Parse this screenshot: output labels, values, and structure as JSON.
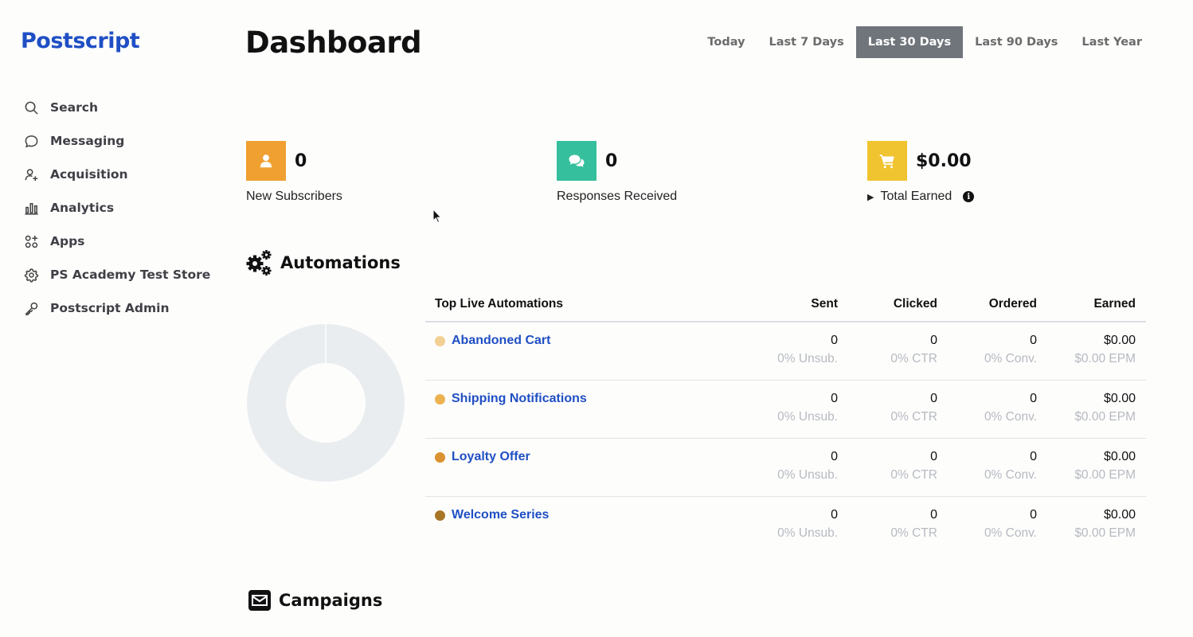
{
  "app": {
    "logo": "Postscript"
  },
  "sidebar": {
    "items": [
      {
        "label": "Search",
        "icon": "search-icon"
      },
      {
        "label": "Messaging",
        "icon": "chat-bubble-icon"
      },
      {
        "label": "Acquisition",
        "icon": "add-user-icon"
      },
      {
        "label": "Analytics",
        "icon": "bar-chart-icon"
      },
      {
        "label": "Apps",
        "icon": "apps-grid-icon"
      },
      {
        "label": "PS Academy Test Store",
        "icon": "gear-icon"
      },
      {
        "label": "Postscript Admin",
        "icon": "key-icon"
      }
    ]
  },
  "header": {
    "title": "Dashboard",
    "ranges": [
      "Today",
      "Last 7 Days",
      "Last 30 Days",
      "Last 90 Days",
      "Last Year"
    ],
    "active_range": "Last 30 Days"
  },
  "stats": [
    {
      "value": "0",
      "label": "New Subscribers",
      "color": "#f0a030",
      "icon": "user-icon"
    },
    {
      "value": "0",
      "label": "Responses Received",
      "color": "#36bf9c",
      "icon": "comments-icon"
    },
    {
      "value": "$0.00",
      "label": "Total Earned",
      "color": "#f0c330",
      "icon": "cart-icon"
    }
  ],
  "automations": {
    "title": "Automations",
    "table_title": "Top Live Automations",
    "columns": [
      "Sent",
      "Clicked",
      "Ordered",
      "Earned"
    ],
    "rows": [
      {
        "name": "Abandoned Cart",
        "color": "#f3cf93",
        "sent": "0",
        "sent_sub": "0% Unsub.",
        "clicked": "0",
        "clicked_sub": "0% CTR",
        "ordered": "0",
        "ordered_sub": "0% Conv.",
        "earned": "$0.00",
        "earned_sub": "$0.00 EPM"
      },
      {
        "name": "Shipping Notifications",
        "color": "#ecb24f",
        "sent": "0",
        "sent_sub": "0% Unsub.",
        "clicked": "0",
        "clicked_sub": "0% CTR",
        "ordered": "0",
        "ordered_sub": "0% Conv.",
        "earned": "$0.00",
        "earned_sub": "$0.00 EPM"
      },
      {
        "name": "Loyalty Offer",
        "color": "#db9231",
        "sent": "0",
        "sent_sub": "0% Unsub.",
        "clicked": "0",
        "clicked_sub": "0% CTR",
        "ordered": "0",
        "ordered_sub": "0% Conv.",
        "earned": "$0.00",
        "earned_sub": "$0.00 EPM"
      },
      {
        "name": "Welcome Series",
        "color": "#a87527",
        "sent": "0",
        "sent_sub": "0% Unsub.",
        "clicked": "0",
        "clicked_sub": "0% CTR",
        "ordered": "0",
        "ordered_sub": "0% Conv.",
        "earned": "$0.00",
        "earned_sub": "$0.00 EPM"
      }
    ]
  },
  "campaigns": {
    "title": "Campaigns"
  },
  "colors": {
    "accent": "#1f4fc4",
    "active_range_bg": "#70757b",
    "donut_empty": "#eaedf0"
  }
}
